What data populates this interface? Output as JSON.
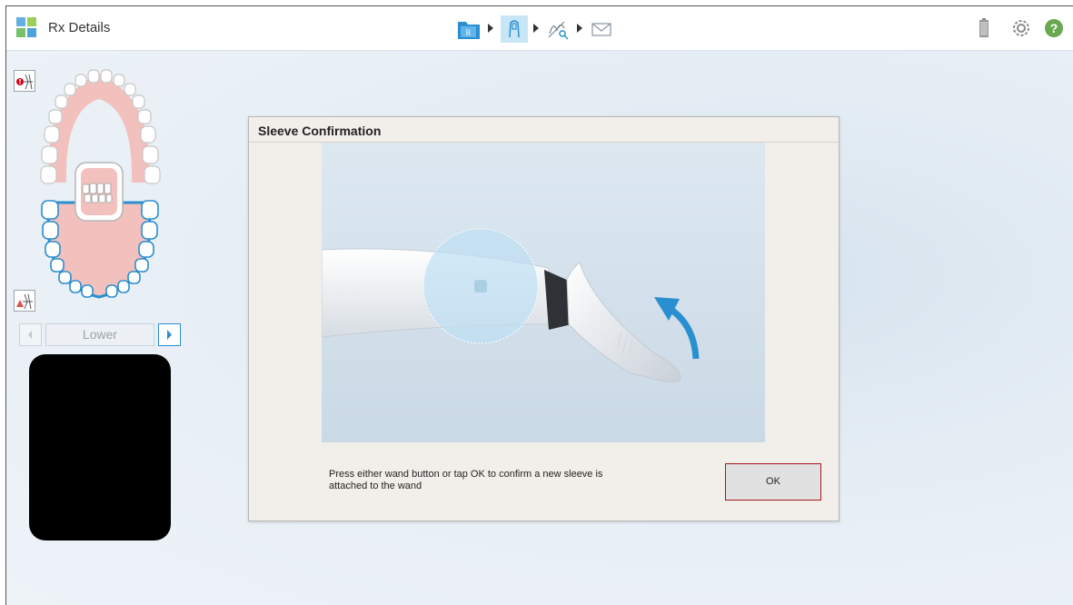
{
  "header": {
    "title": "Rx Details",
    "app_icon": "app-grid-icon",
    "wizard_steps": [
      {
        "name": "rx-step",
        "icon": "rx-folder-icon",
        "label": "R"
      },
      {
        "name": "scan-step",
        "icon": "scan-wand-icon"
      },
      {
        "name": "view-step",
        "icon": "view-tooth-icon"
      },
      {
        "name": "send-step",
        "icon": "envelope-icon"
      }
    ],
    "right_icons": [
      "battery-icon",
      "gear-icon",
      "help-icon"
    ],
    "help_label": "?"
  },
  "sidebar": {
    "jaw_nav_label": "Lower",
    "upper_icon": "upper-jaw-warning-icon",
    "lower_icon": "lower-jaw-icon"
  },
  "dialog": {
    "title": "Sleeve Confirmation",
    "message": "Press either wand button or tap OK to confirm a new sleeve is attached to the wand",
    "ok_label": "OK"
  },
  "colors": {
    "accent": "#2a8fd0",
    "ok_border": "#a4181c",
    "gum": "#f2c1bd",
    "help_green": "#6aa84f"
  }
}
